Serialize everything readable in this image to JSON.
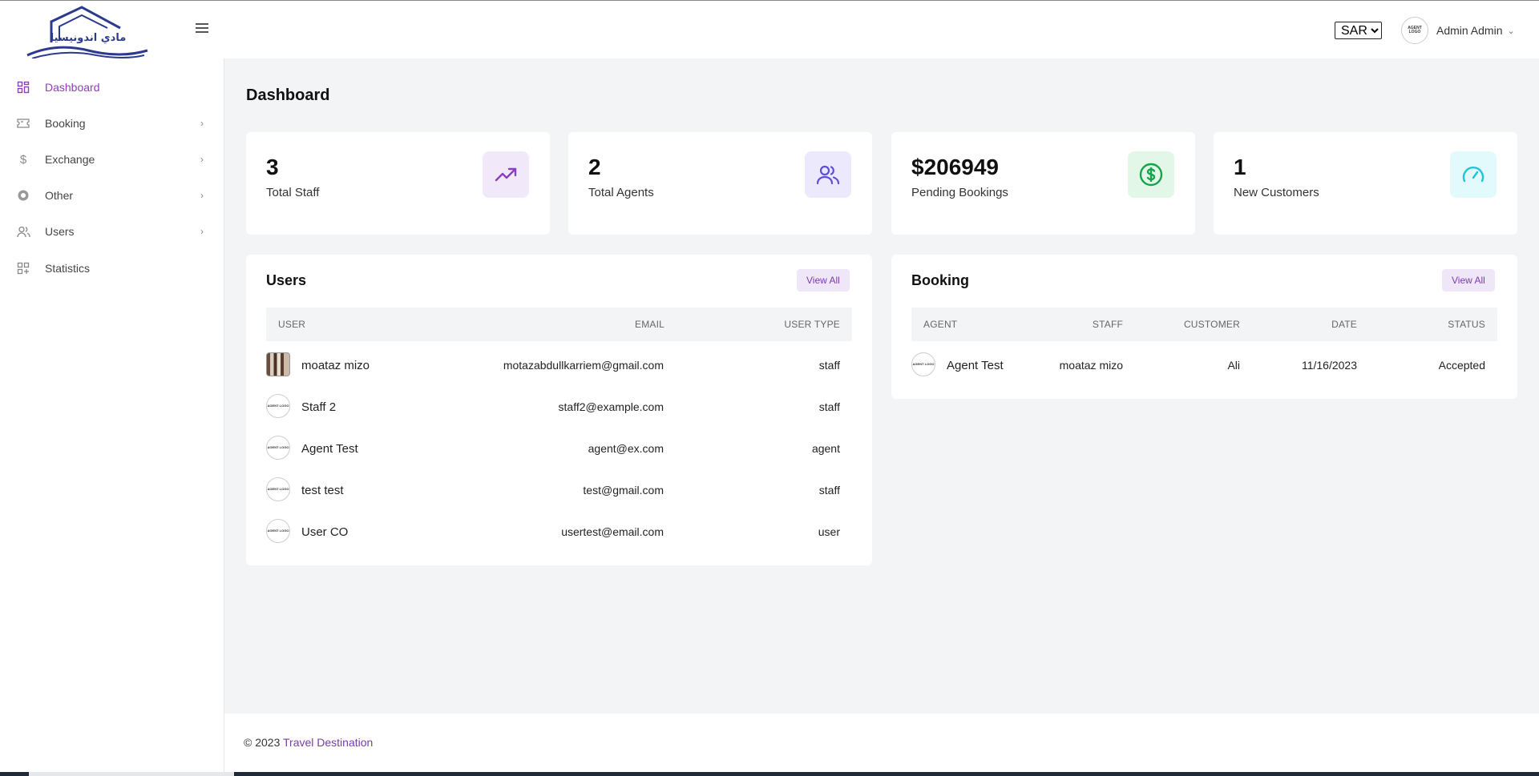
{
  "header": {
    "logo_text": "مادي اندونيسيا",
    "currency": {
      "selected": "SAR",
      "options": [
        "SAR"
      ]
    },
    "user": {
      "avatar_text": "AGENT LOGO",
      "name": "Admin Admin"
    }
  },
  "sidebar": {
    "items": [
      {
        "label": "Dashboard",
        "icon": "dashboard-icon",
        "active": true,
        "has_children": false
      },
      {
        "label": "Booking",
        "icon": "ticket-icon",
        "active": false,
        "has_children": true
      },
      {
        "label": "Exchange",
        "icon": "dollar-icon",
        "active": false,
        "has_children": true
      },
      {
        "label": "Other",
        "icon": "circle-icon",
        "active": false,
        "has_children": true
      },
      {
        "label": "Users",
        "icon": "users-icon",
        "active": false,
        "has_children": true
      },
      {
        "label": "Statistics",
        "icon": "statistics-icon",
        "active": false,
        "has_children": false
      }
    ]
  },
  "page": {
    "title": "Dashboard"
  },
  "stats": [
    {
      "value": "3",
      "label": "Total Staff",
      "icon": "trending-up-icon",
      "color": "#8b3fb8",
      "bg": "#f1e8fa"
    },
    {
      "value": "2",
      "label": "Total Agents",
      "icon": "users-icon",
      "color": "#5b4fd8",
      "bg": "#ece9fc"
    },
    {
      "value": "$206949",
      "label": "Pending Bookings",
      "icon": "dollar-circle-icon",
      "color": "#16a34a",
      "bg": "#e3f7e8"
    },
    {
      "value": "1",
      "label": "New Customers",
      "icon": "speedometer-icon",
      "color": "#22c3d8",
      "bg": "#e3fafc"
    }
  ],
  "users_card": {
    "title": "Users",
    "view_all": "View All",
    "columns": [
      "USER",
      "EMAIL",
      "USER TYPE"
    ],
    "rows": [
      {
        "name": "moataz mizo",
        "email": "motazabdullkarriem@gmail.com",
        "type": "staff",
        "avatar": "photo"
      },
      {
        "name": "Staff 2",
        "email": "staff2@example.com",
        "type": "staff",
        "avatar": "logo"
      },
      {
        "name": "Agent Test",
        "email": "agent@ex.com",
        "type": "agent",
        "avatar": "logo"
      },
      {
        "name": "test test",
        "email": "test@gmail.com",
        "type": "staff",
        "avatar": "logo"
      },
      {
        "name": "User CO",
        "email": "usertest@email.com",
        "type": "user",
        "avatar": "logo"
      }
    ]
  },
  "booking_card": {
    "title": "Booking",
    "view_all": "View All",
    "columns": [
      "AGENT",
      "STAFF",
      "CUSTOMER",
      "DATE",
      "STATUS"
    ],
    "rows": [
      {
        "agent": "Agent Test",
        "staff": "moataz mizo",
        "customer": "Ali",
        "date": "11/16/2023",
        "status": "Accepted"
      }
    ]
  },
  "avatar_logo_text": "AGENT LOGO",
  "footer": {
    "prefix": "© 2023",
    "link": "Travel Destination"
  },
  "colors": {
    "accent": "#8b3fb8",
    "background": "#f3f4f6"
  }
}
